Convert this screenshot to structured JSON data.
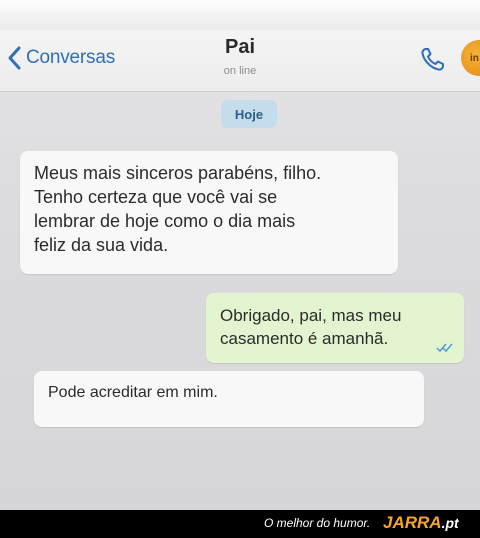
{
  "navbar": {
    "back_label": "Conversas",
    "contact_name": "Pai",
    "contact_status": "on line",
    "avatar_text": "in"
  },
  "date_separator": "Hoje",
  "messages": [
    {
      "direction": "incoming",
      "lines": [
        "Meus mais sinceros parabéns, filho.",
        "Tenho certeza que você vai se",
        "lembrar de hoje como o dia mais",
        "feliz da sua vida."
      ]
    },
    {
      "direction": "outgoing",
      "lines": [
        "Obrigado, pai, mas meu",
        "casamento é amanhã."
      ],
      "read_receipt": "double-check-icon"
    },
    {
      "direction": "incoming",
      "lines": [
        "Pode acreditar em mim."
      ]
    }
  ],
  "footer": {
    "tagline": "O melhor do humor.",
    "brand": "JARRA",
    "brand_tld": ".pt"
  },
  "colors": {
    "link_blue": "#2f6fb8",
    "incoming_bubble": "#f8f8f9",
    "outgoing_bubble": "#e3f5d0",
    "date_chip": "#c5dcec",
    "brand_orange": "#f5a623"
  },
  "icons": {
    "back": "chevron-left-icon",
    "call": "phone-icon",
    "read": "double-check-icon"
  }
}
